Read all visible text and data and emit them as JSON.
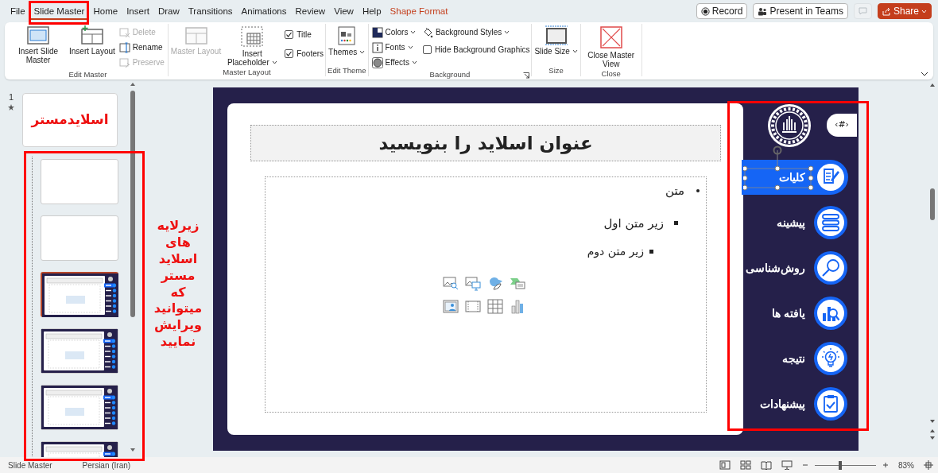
{
  "menu_tabs": [
    {
      "label": "File",
      "selected": false,
      "contextual": false
    },
    {
      "label": "Slide Master",
      "selected": true,
      "contextual": false
    },
    {
      "label": "Home",
      "selected": false,
      "contextual": false
    },
    {
      "label": "Insert",
      "selected": false,
      "contextual": false
    },
    {
      "label": "Draw",
      "selected": false,
      "contextual": false
    },
    {
      "label": "Transitions",
      "selected": false,
      "contextual": false
    },
    {
      "label": "Animations",
      "selected": false,
      "contextual": false
    },
    {
      "label": "Review",
      "selected": false,
      "contextual": false
    },
    {
      "label": "View",
      "selected": false,
      "contextual": false
    },
    {
      "label": "Help",
      "selected": false,
      "contextual": false
    },
    {
      "label": "Shape Format",
      "selected": false,
      "contextual": true
    }
  ],
  "title_buttons": [
    {
      "kind": "record",
      "label": "Record"
    },
    {
      "kind": "teams",
      "label": "Present in Teams"
    },
    {
      "kind": "comments",
      "disabled": true
    },
    {
      "kind": "share",
      "label": "Share"
    }
  ],
  "ribbon": {
    "groups": [
      {
        "label": "Edit Master",
        "columns": [
          {
            "controls": [
              {
                "kind": "large",
                "label": "Insert Slide Master",
                "disabled": false,
                "dropdown": false
              }
            ]
          },
          {
            "controls": [
              {
                "kind": "large",
                "label": "Insert Layout",
                "disabled": false,
                "dropdown": false
              }
            ]
          },
          {
            "controls": [
              {
                "kind": "small",
                "label": "Delete",
                "disabled": true,
                "dropdown": false
              },
              {
                "kind": "small",
                "label": "Rename",
                "disabled": false,
                "dropdown": false
              },
              {
                "kind": "small",
                "label": "Preserve",
                "disabled": true,
                "dropdown": false
              }
            ]
          }
        ]
      },
      {
        "label": "Master Layout",
        "columns": [
          {
            "controls": [
              {
                "kind": "large",
                "label": "Master Layout",
                "disabled": true,
                "dropdown": false
              }
            ]
          },
          {
            "controls": [
              {
                "kind": "large",
                "label": "Insert Placeholder",
                "disabled": false,
                "dropdown": true
              }
            ]
          },
          {
            "controls": [
              {
                "kind": "check",
                "label": "Title",
                "checked": true
              },
              {
                "kind": "check",
                "label": "Footers",
                "checked": true
              }
            ]
          }
        ]
      },
      {
        "label": "Edit Theme",
        "columns": [
          {
            "controls": [
              {
                "kind": "large",
                "label": "Themes",
                "disabled": false,
                "dropdown": true
              }
            ]
          }
        ]
      },
      {
        "label": "Background",
        "dialog_launcher": true,
        "columns": [
          {
            "controls": [
              {
                "kind": "small",
                "label": "Colors",
                "disabled": false,
                "dropdown": true
              },
              {
                "kind": "small",
                "label": "Fonts",
                "disabled": false,
                "dropdown": true
              },
              {
                "kind": "small",
                "label": "Effects",
                "disabled": false,
                "dropdown": true
              }
            ]
          },
          {
            "controls": [
              {
                "kind": "small",
                "label": "Background Styles",
                "disabled": false,
                "dropdown": true
              },
              {
                "kind": "check",
                "label": "Hide Background Graphics",
                "checked": false
              }
            ]
          }
        ]
      },
      {
        "label": "Size",
        "columns": [
          {
            "controls": [
              {
                "kind": "large",
                "label": "Slide Size",
                "disabled": false,
                "dropdown": true
              }
            ]
          }
        ]
      },
      {
        "label": "Close",
        "columns": [
          {
            "controls": [
              {
                "kind": "large",
                "label": "Close Master View",
                "disabled": false,
                "dropdown": false
              }
            ]
          }
        ]
      }
    ]
  },
  "thumbnails": {
    "number": "1",
    "master": {
      "label": "اسلایدمستر",
      "selected": false
    },
    "layouts": [
      {
        "kind": "blank",
        "selected": false
      },
      {
        "kind": "blank",
        "selected": false
      },
      {
        "kind": "content",
        "selected": true
      },
      {
        "kind": "content",
        "selected": false
      },
      {
        "kind": "content",
        "selected": false
      },
      {
        "kind": "content",
        "selected": false
      }
    ]
  },
  "annotation": "زیرلایه های اسلاید مستر که میتوانید ویرایش نمایید",
  "slide": {
    "title": "عنوان اسلاید را بنویسید",
    "bullets": [
      {
        "text": "متن",
        "children": [
          {
            "text": "زیر متن اول",
            "children": [
              {
                "text": "زیر متن دوم"
              }
            ]
          }
        ]
      }
    ],
    "page_number": "‹#›",
    "nav_items": [
      {
        "label": "کلیات",
        "selected": true
      },
      {
        "label": "پیشینه",
        "selected": false
      },
      {
        "label": "روش‌شناسی",
        "selected": false
      },
      {
        "label": "یافته ها",
        "selected": false
      },
      {
        "label": "نتیجه",
        "selected": false
      },
      {
        "label": "پیشنهادات",
        "selected": false
      }
    ]
  },
  "status_bar": {
    "left": [
      "Slide Master",
      "Persian (Iran)"
    ],
    "zoom": {
      "level": 0.42,
      "reading": "83%"
    }
  }
}
